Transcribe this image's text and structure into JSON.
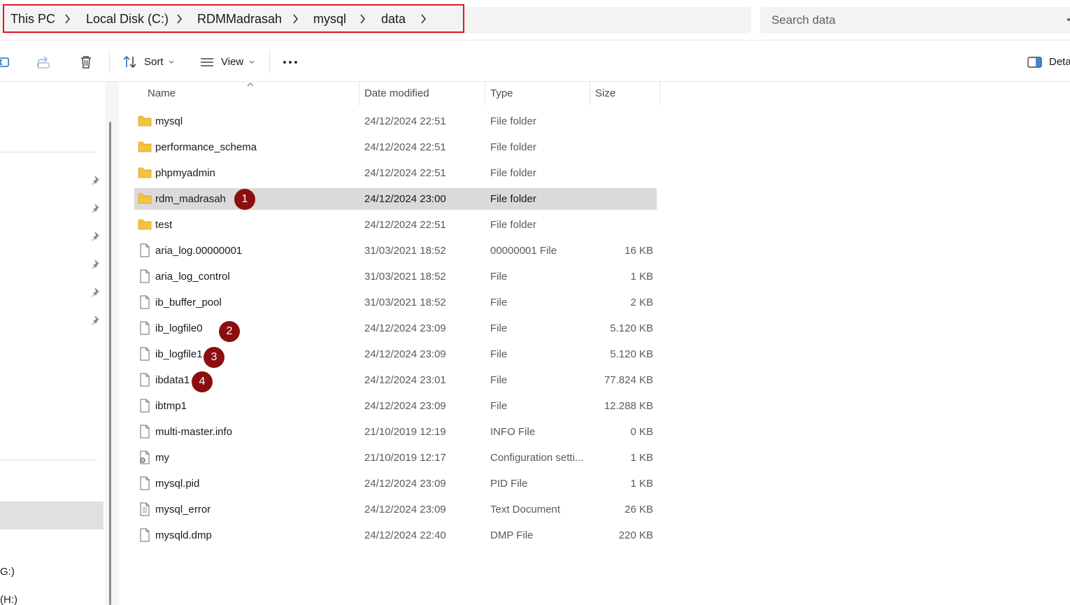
{
  "breadcrumb": {
    "items": [
      "This PC",
      "Local Disk (C:)",
      "RDMMadrasah",
      "mysql",
      "data"
    ]
  },
  "search": {
    "placeholder": "Search data"
  },
  "toolbar": {
    "sort_label": "Sort",
    "view_label": "View",
    "details_label": "Deta"
  },
  "sidebar": {
    "drives": [
      "G:)",
      "(H:)"
    ]
  },
  "columns": {
    "name": "Name",
    "date": "Date modified",
    "type": "Type",
    "size": "Size"
  },
  "files": [
    {
      "name": "mysql",
      "date": "24/12/2024 22:51",
      "type": "File folder",
      "size": "",
      "icon": "folder-icon"
    },
    {
      "name": "performance_schema",
      "date": "24/12/2024 22:51",
      "type": "File folder",
      "size": "",
      "icon": "folder-icon"
    },
    {
      "name": "phpmyadmin",
      "date": "24/12/2024 22:51",
      "type": "File folder",
      "size": "",
      "icon": "folder-icon"
    },
    {
      "name": "rdm_madrasah",
      "date": "24/12/2024 23:00",
      "type": "File folder",
      "size": "",
      "icon": "folder-icon",
      "selected": true
    },
    {
      "name": "test",
      "date": "24/12/2024 22:51",
      "type": "File folder",
      "size": "",
      "icon": "folder-icon"
    },
    {
      "name": "aria_log.00000001",
      "date": "31/03/2021 18:52",
      "type": "00000001 File",
      "size": "16 KB",
      "icon": "file-icon"
    },
    {
      "name": "aria_log_control",
      "date": "31/03/2021 18:52",
      "type": "File",
      "size": "1 KB",
      "icon": "file-icon"
    },
    {
      "name": "ib_buffer_pool",
      "date": "31/03/2021 18:52",
      "type": "File",
      "size": "2 KB",
      "icon": "file-icon"
    },
    {
      "name": "ib_logfile0",
      "date": "24/12/2024 23:09",
      "type": "File",
      "size": "5.120 KB",
      "icon": "file-icon"
    },
    {
      "name": "ib_logfile1",
      "date": "24/12/2024 23:09",
      "type": "File",
      "size": "5.120 KB",
      "icon": "file-icon"
    },
    {
      "name": "ibdata1",
      "date": "24/12/2024 23:01",
      "type": "File",
      "size": "77.824 KB",
      "icon": "file-icon"
    },
    {
      "name": "ibtmp1",
      "date": "24/12/2024 23:09",
      "type": "File",
      "size": "12.288 KB",
      "icon": "file-icon"
    },
    {
      "name": "multi-master.info",
      "date": "21/10/2019 12:19",
      "type": "INFO File",
      "size": "0 KB",
      "icon": "file-icon"
    },
    {
      "name": "my",
      "date": "21/10/2019 12:17",
      "type": "Configuration setti...",
      "size": "1 KB",
      "icon": "config-file-icon"
    },
    {
      "name": "mysql.pid",
      "date": "24/12/2024 23:09",
      "type": "PID File",
      "size": "1 KB",
      "icon": "file-icon"
    },
    {
      "name": "mysql_error",
      "date": "24/12/2024 23:09",
      "type": "Text Document",
      "size": "26 KB",
      "icon": "text-file-icon"
    },
    {
      "name": "mysqld.dmp",
      "date": "24/12/2024 22:40",
      "type": "DMP File",
      "size": "220 KB",
      "icon": "file-icon"
    }
  ],
  "annotations": {
    "badge1": "1",
    "badge2": "2",
    "badge3": "3",
    "badge4": "4"
  },
  "colors": {
    "annotation_badge": "#8b0f0f",
    "highlight_outline": "#e0161d",
    "folder": "#f5c342",
    "selected_row": "#dadada"
  }
}
